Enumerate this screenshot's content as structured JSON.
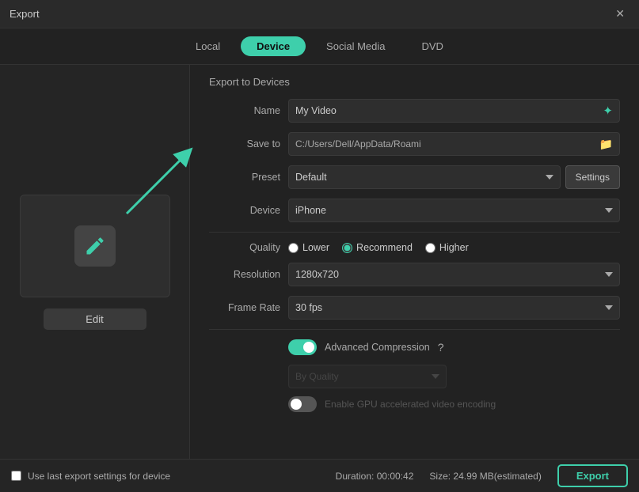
{
  "window": {
    "title": "Export",
    "close_label": "✕"
  },
  "tabs": [
    {
      "id": "local",
      "label": "Local",
      "active": false
    },
    {
      "id": "device",
      "label": "Device",
      "active": true
    },
    {
      "id": "social-media",
      "label": "Social Media",
      "active": false
    },
    {
      "id": "dvd",
      "label": "DVD",
      "active": false
    }
  ],
  "left_panel": {
    "edit_button_label": "Edit"
  },
  "right_panel": {
    "section_title": "Export to Devices",
    "name_label": "Name",
    "name_value": "My Video",
    "save_to_label": "Save to",
    "save_to_path": "C:/Users/Dell/AppData/Roami",
    "preset_label": "Preset",
    "preset_value": "Default",
    "settings_label": "Settings",
    "device_label": "Device",
    "device_value": "iPhone",
    "quality_label": "Quality",
    "quality_lower": "Lower",
    "quality_recommend": "Recommend",
    "quality_higher": "Higher",
    "resolution_label": "Resolution",
    "resolution_value": "1280x720",
    "frame_rate_label": "Frame Rate",
    "frame_rate_value": "30 fps",
    "advanced_compression_label": "Advanced Compression",
    "by_quality_value": "By Quality",
    "gpu_label": "Enable GPU accelerated video encoding"
  },
  "footer": {
    "checkbox_label": "Use last export settings for device",
    "duration_label": "Duration: 00:00:42",
    "size_label": "Size: 24.99 MB(estimated)",
    "export_button_label": "Export"
  },
  "colors": {
    "accent": "#3ecfab"
  }
}
